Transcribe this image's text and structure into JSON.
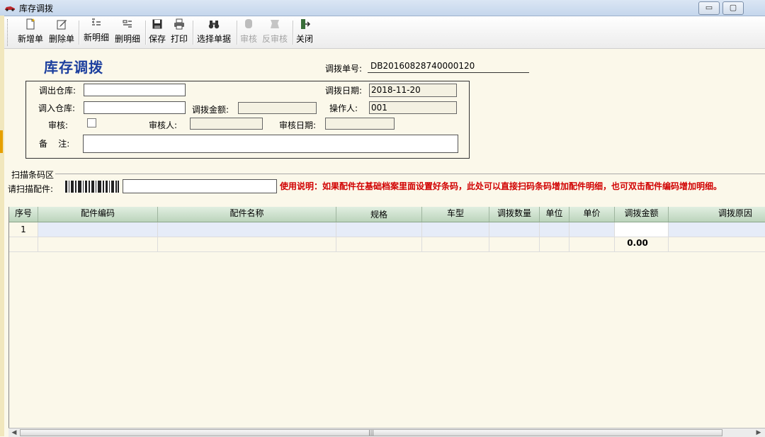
{
  "window": {
    "title": "库存调拨",
    "min": "▭",
    "max": "▢",
    "close": "✕"
  },
  "toolbar": {
    "new_doc": "新增单",
    "delete_doc": "删除单",
    "new_detail": "新明细",
    "delete_detail": "删明细",
    "save": "保存",
    "print": "打印",
    "select_doc": "选择单据",
    "audit": "审核",
    "unaudit": "反审核",
    "close": "关闭"
  },
  "form": {
    "title": "库存调拨",
    "doc_no_label": "调拨单号:",
    "doc_no": "DB20160828740000120",
    "out_warehouse_label": "调出仓库:",
    "out_warehouse": "",
    "in_warehouse_label": "调入仓库:",
    "in_warehouse": "",
    "date_label": "调拨日期:",
    "date": "2018-11-20",
    "amount_label": "调拨金额:",
    "amount": "",
    "operator_label": "操作人:",
    "operator": "001",
    "audit_label": "审核:",
    "auditor_label": "审核人:",
    "auditor": "",
    "audit_date_label": "审核日期:",
    "audit_date": "",
    "remark_label": "备    注:",
    "remark": ""
  },
  "scan": {
    "legend": "扫描条码区",
    "label": "请扫描配件:",
    "hint": "使用说明：如果配件在基础档案里面设置好条码，此处可以直接扫码条码增加配件明细，也可双击配件编码增加明细。"
  },
  "grid": {
    "columns": [
      "序号",
      "配件编码",
      "配件名称",
      "规格",
      "车型",
      "调拨数量",
      "单位",
      "单价",
      "调拨金额",
      "调拨原因"
    ],
    "rows": [
      {
        "no": "1"
      }
    ],
    "total_amount": "0.00"
  },
  "scrollbar": {
    "left": "◀",
    "right": "▶",
    "grip": "|||"
  }
}
